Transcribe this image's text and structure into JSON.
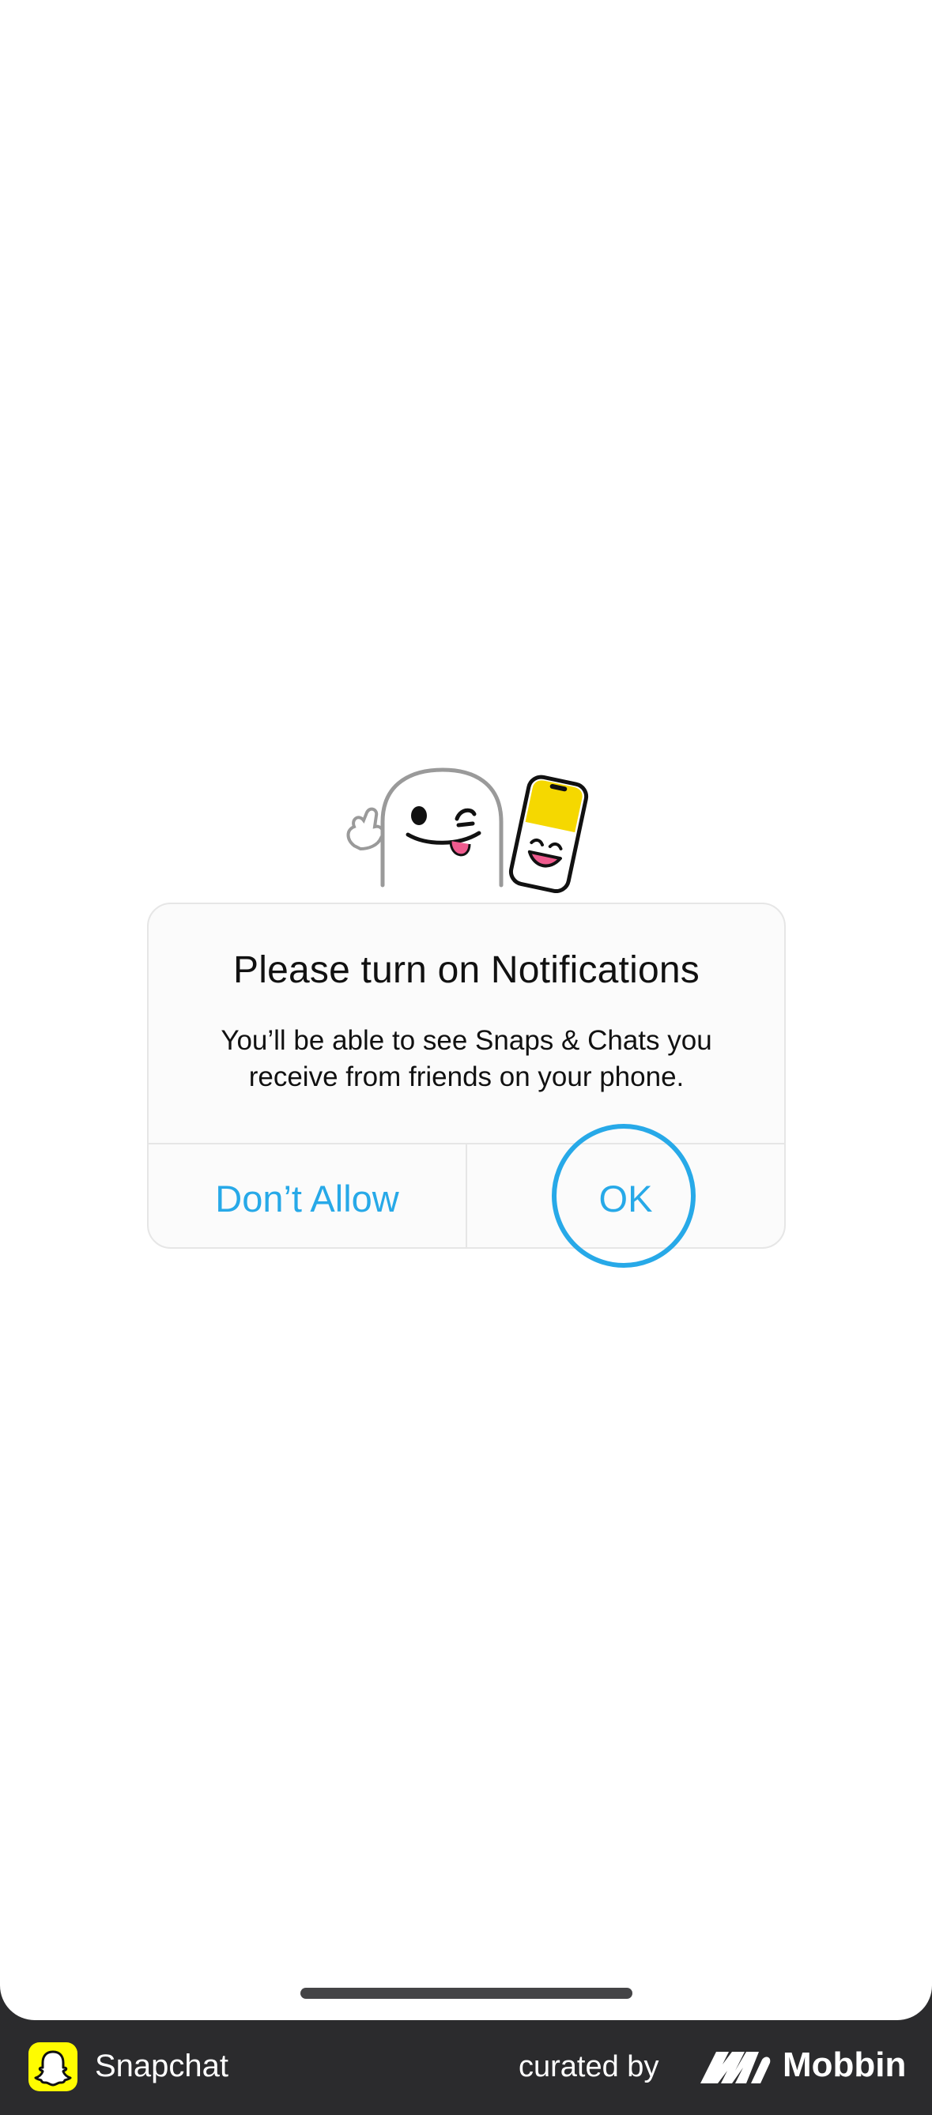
{
  "dialog": {
    "title": "Please turn on Notifications",
    "message": "You’ll be able to see Snaps & Chats you receive from friends on your phone.",
    "deny_label": "Don’t Allow",
    "ok_label": "OK"
  },
  "footer": {
    "app_name": "Snapchat",
    "curated_by": "curated by",
    "brand": "Mobbin"
  },
  "colors": {
    "accent": "#27a9e8",
    "snap_yellow": "#fffc00",
    "footer_bg": "#2b2b2d"
  },
  "icons": {
    "illustration": "ghost-winking-with-phone-illustration",
    "app_icon": "snapchat-ghost-icon",
    "brand_logo": "mobbin-logo-icon"
  }
}
